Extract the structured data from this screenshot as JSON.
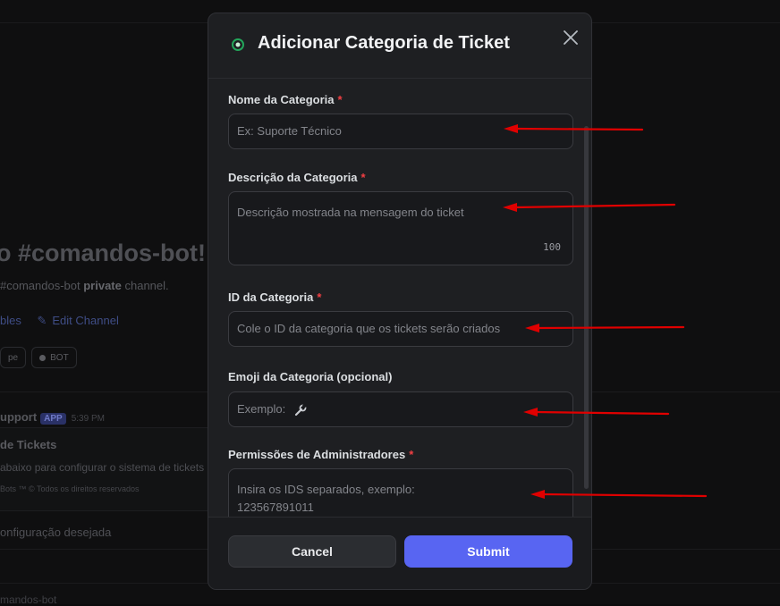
{
  "background": {
    "channel_welcome": "o #comandos-bot!",
    "channel_sub_prefix": "#comandos-bot ",
    "channel_sub_bold": "private",
    "channel_sub_suffix": " channel.",
    "links_left": "bles",
    "edit_channel": "Edit Channel",
    "chip_1": "pe",
    "chip_2": "BOT",
    "message_author": "upport",
    "app_tag": "APP",
    "message_time": "5:39 PM",
    "embed_title": "de Tickets",
    "embed_desc": "abaixo para configurar o sistema de tickets",
    "embed_footer": "Bots ™ © Todos os direitos reservados",
    "select_placeholder": "onfiguração desejada",
    "bottom_text": "mandos-bot"
  },
  "modal": {
    "title": "Adicionar Categoria de Ticket",
    "fields": {
      "nome": {
        "label": "Nome da Categoria",
        "required": "*",
        "placeholder": "Ex: Suporte Técnico"
      },
      "descricao": {
        "label": "Descrição da Categoria",
        "required": "*",
        "placeholder": "Descrição mostrada na mensagem do ticket",
        "counter": "100"
      },
      "id": {
        "label": "ID da Categoria",
        "required": "*",
        "placeholder": "Cole o ID da categoria que os tickets serão criados"
      },
      "emoji": {
        "label": "Emoji da Categoria (opcional)",
        "placeholder": "Exemplo:"
      },
      "permissoes": {
        "label": "Permissões de Administradores",
        "required": "*",
        "placeholder_line1": "Insira os IDS separados, exemplo:",
        "placeholder_line2": "123567891011"
      }
    },
    "buttons": {
      "cancel": "Cancel",
      "submit": "Submit"
    }
  },
  "colors": {
    "accent": "#5865f2",
    "required": "#f23f43",
    "annotation_arrow": "#e00000",
    "header_icon": "#23a55a"
  },
  "icons": [
    "close-icon",
    "header-app-icon",
    "wrench-icon",
    "pencil-icon"
  ]
}
